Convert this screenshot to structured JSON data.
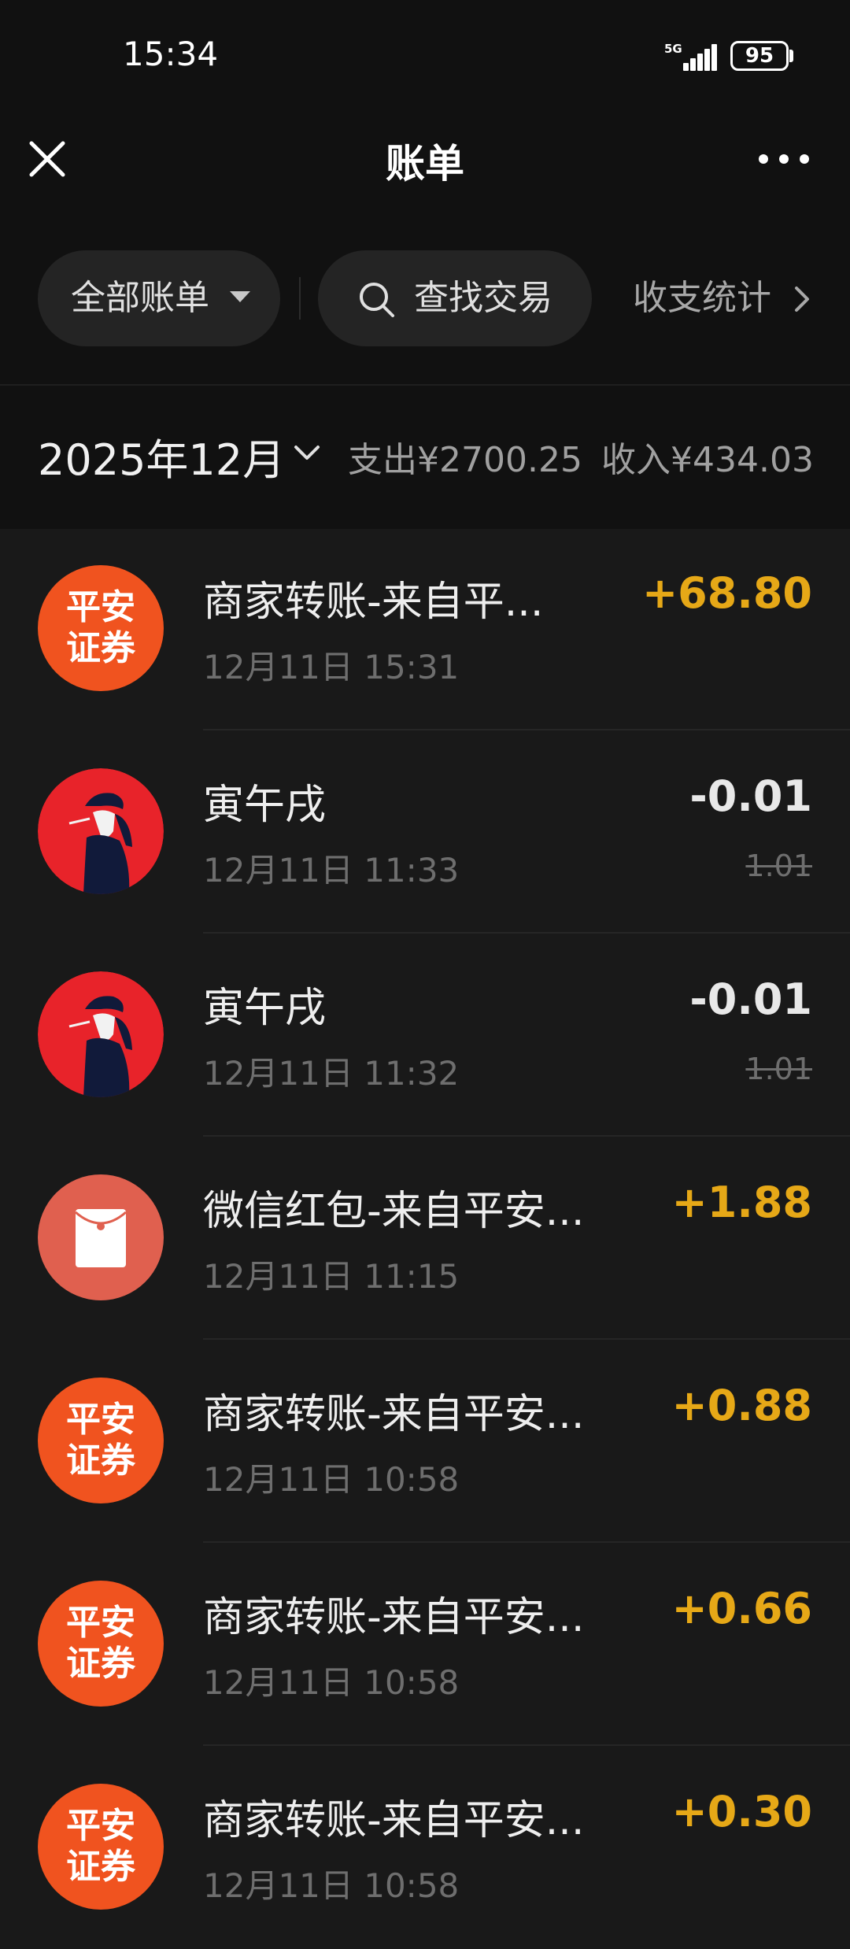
{
  "status_bar": {
    "time": "15:34",
    "network": "5G",
    "battery": "95"
  },
  "header": {
    "title": "账单"
  },
  "filters": {
    "all_bills": "全部账单",
    "search": "查找交易",
    "stats": "收支统计"
  },
  "summary": {
    "month": "2025年12月",
    "expense": "支出¥2700.25",
    "income": "收入¥434.03"
  },
  "avatar_text": {
    "pingan_line1": "平安",
    "pingan_line2": "证券"
  },
  "transactions": [
    {
      "name": "商家转账-来自平...",
      "date": "12月11日 15:31",
      "amount": "+68.80",
      "type": "income",
      "avatar": "pingan"
    },
    {
      "name": "寅午戌",
      "date": "12月11日 11:33",
      "amount": "-0.01",
      "original": "1.01",
      "type": "expense",
      "avatar": "figure"
    },
    {
      "name": "寅午戌",
      "date": "12月11日 11:32",
      "amount": "-0.01",
      "original": "1.01",
      "type": "expense",
      "avatar": "figure"
    },
    {
      "name": "微信红包-来自平安...",
      "date": "12月11日 11:15",
      "amount": "+1.88",
      "type": "income",
      "avatar": "red-packet"
    },
    {
      "name": "商家转账-来自平安...",
      "date": "12月11日 10:58",
      "amount": "+0.88",
      "type": "income",
      "avatar": "pingan"
    },
    {
      "name": "商家转账-来自平安...",
      "date": "12月11日 10:58",
      "amount": "+0.66",
      "type": "income",
      "avatar": "pingan"
    },
    {
      "name": "商家转账-来自平安...",
      "date": "12月11日 10:58",
      "amount": "+0.30",
      "type": "income",
      "avatar": "pingan"
    }
  ],
  "colors": {
    "income": "#e6a817",
    "pingan_orange": "#f0531f",
    "red_packet": "#e0604f",
    "figure_red": "#e8232a"
  }
}
